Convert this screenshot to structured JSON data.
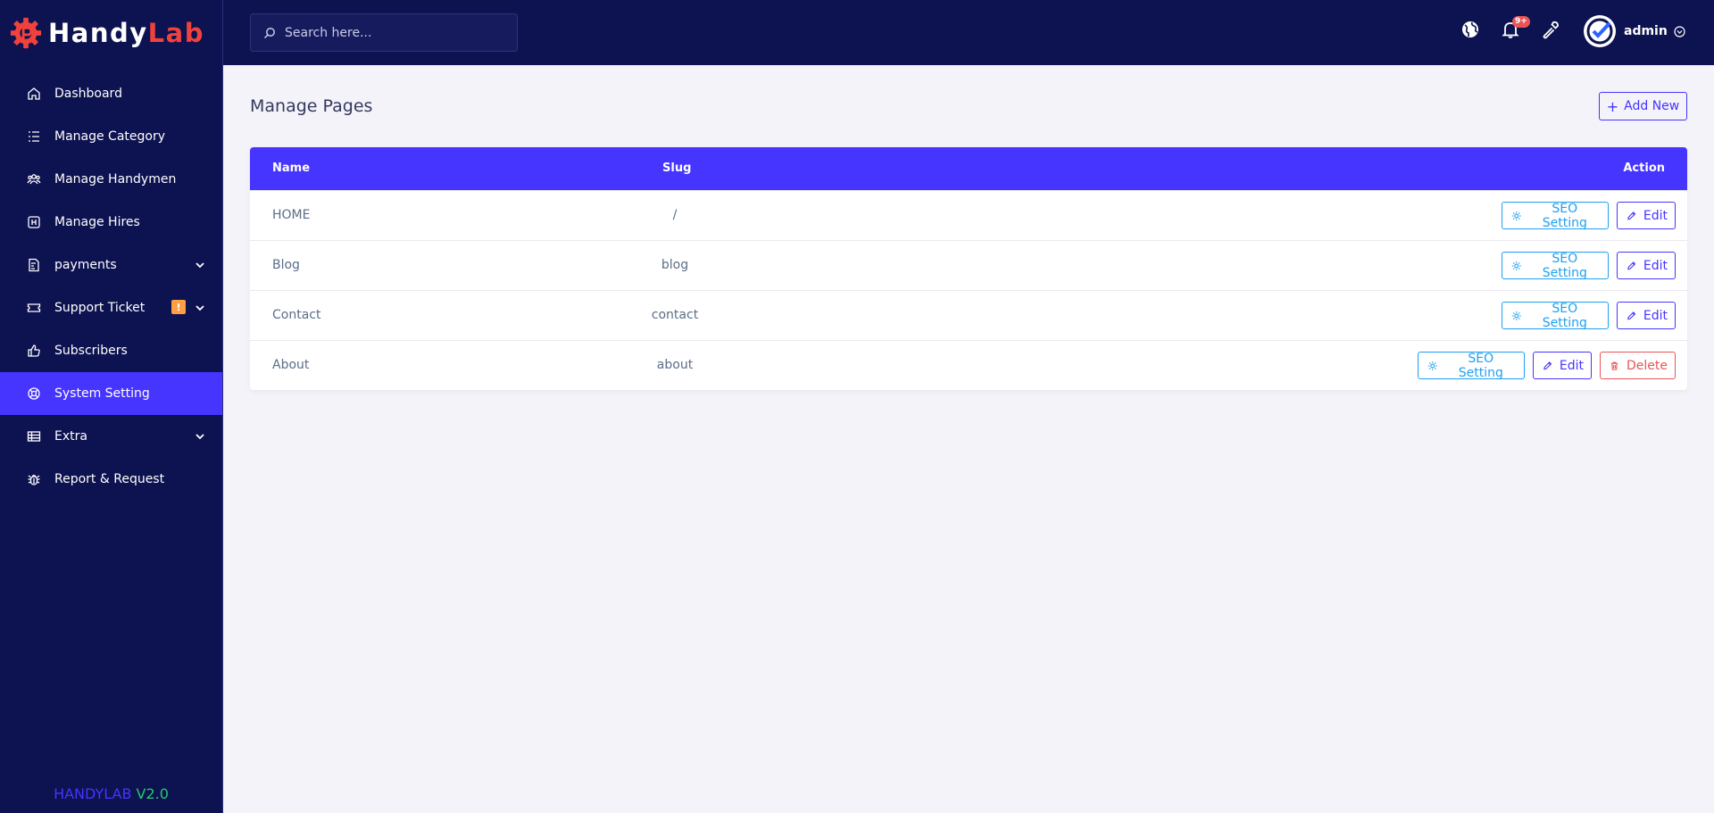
{
  "brand": {
    "name_part1": "Handy",
    "name_part2": "Lab"
  },
  "sidebar": {
    "items": [
      {
        "label": "Dashboard",
        "icon": "home-icon"
      },
      {
        "label": "Manage Category",
        "icon": "list-icon"
      },
      {
        "label": "Manage Handymen",
        "icon": "users-icon"
      },
      {
        "label": "Manage Hires",
        "icon": "hires-icon"
      },
      {
        "label": "payments",
        "icon": "invoice-icon"
      },
      {
        "label": "Support Ticket",
        "icon": "ticket-icon",
        "badge": "!"
      },
      {
        "label": "Subscribers",
        "icon": "thumbs-up-icon"
      },
      {
        "label": "System Setting",
        "icon": "life-ring-icon"
      },
      {
        "label": "Extra",
        "icon": "table-icon"
      },
      {
        "label": "Report & Request",
        "icon": "bug-icon"
      }
    ],
    "version_name": "HANDYLAB",
    "version_number": "V2.0"
  },
  "topbar": {
    "search_placeholder": "Search here...",
    "notification_badge": "9+",
    "username": "admin"
  },
  "main": {
    "title": "Manage Pages",
    "add_button": "Add New",
    "table": {
      "headers": {
        "name": "Name",
        "slug": "Slug",
        "action": "Action"
      },
      "rows": [
        {
          "name": "HOME",
          "slug": "/"
        },
        {
          "name": "Blog",
          "slug": "blog"
        },
        {
          "name": "Contact",
          "slug": "contact"
        },
        {
          "name": "About",
          "slug": "about"
        }
      ],
      "seo_label": "SEO Setting",
      "edit_label": "Edit",
      "delete_label": "Delete"
    }
  },
  "colors": {
    "sidebar_bg": "#0d1250",
    "primary": "#4634ff",
    "info": "#1e9ff2",
    "danger": "#ea5455",
    "brand_red": "#f0423c",
    "version_green": "#28c76f"
  }
}
